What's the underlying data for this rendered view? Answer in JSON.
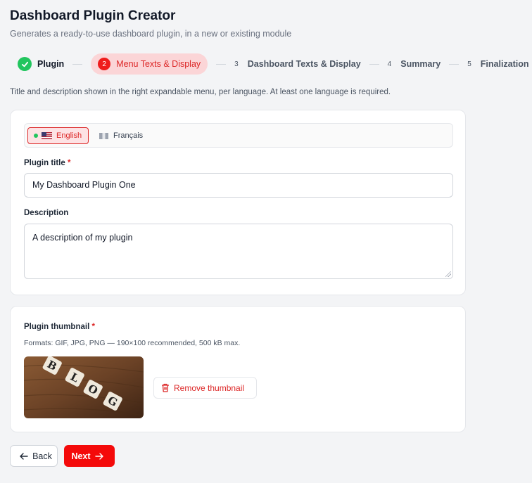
{
  "header": {
    "title": "Dashboard Plugin Creator",
    "subtitle": "Generates a ready-to-use dashboard plugin, in a new or existing module"
  },
  "stepper": {
    "steps": [
      {
        "number": "",
        "label": "Plugin",
        "state": "done"
      },
      {
        "number": "2",
        "label": "Menu Texts & Display",
        "state": "active"
      },
      {
        "number": "3",
        "label": "Dashboard Texts & Display",
        "state": "pending"
      },
      {
        "number": "4",
        "label": "Summary",
        "state": "pending"
      },
      {
        "number": "5",
        "label": "Finalization",
        "state": "pending"
      }
    ]
  },
  "hint": "Title and description shown in the right expandable menu, per language. At least one language is required.",
  "languages": {
    "tabs": [
      {
        "label": "English",
        "flag": "us-flag-icon",
        "active": true
      },
      {
        "label": "Français",
        "flag": "fr-flag-icon",
        "active": false
      }
    ]
  },
  "form": {
    "title_label": "Plugin title",
    "title_value": "My Dashboard Plugin One",
    "description_label": "Description",
    "description_value": "A description of my plugin",
    "required_mark": "*"
  },
  "thumbnail": {
    "label": "Plugin thumbnail",
    "formats": "Formats: GIF, JPG, PNG — 190×100 recommended, 500 kB max.",
    "image_letters": [
      "B",
      "L",
      "O",
      "G"
    ],
    "remove_label": "Remove thumbnail"
  },
  "footer": {
    "back_label": "Back",
    "next_label": "Next"
  },
  "colors": {
    "accent": "#ef1c1c",
    "success": "#22c55e",
    "active_bg": "#fbd5d7"
  }
}
